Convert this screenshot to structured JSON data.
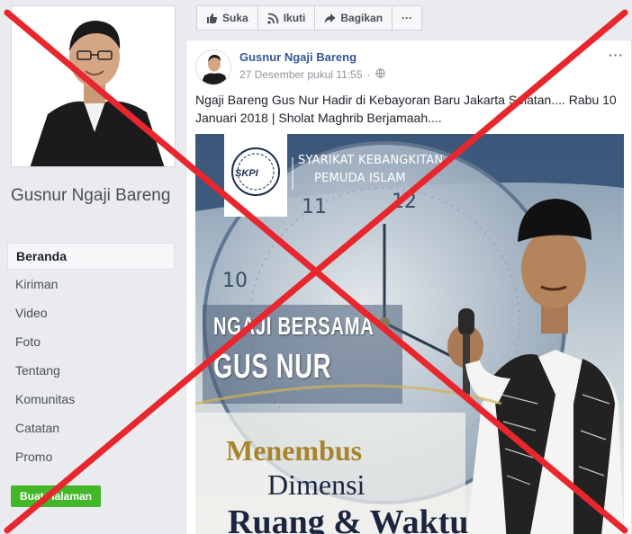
{
  "page": {
    "name": "Gusnur Ngaji Bareng"
  },
  "sidebar": {
    "items": [
      {
        "label": "Beranda",
        "active": true
      },
      {
        "label": "Kiriman",
        "active": false
      },
      {
        "label": "Video",
        "active": false
      },
      {
        "label": "Foto",
        "active": false
      },
      {
        "label": "Tentang",
        "active": false
      },
      {
        "label": "Komunitas",
        "active": false
      },
      {
        "label": "Catatan",
        "active": false
      },
      {
        "label": "Promo",
        "active": false
      }
    ],
    "create_button": "Buat Halaman"
  },
  "actions": {
    "like": "Suka",
    "follow": "Ikuti",
    "share": "Bagikan",
    "more": "···"
  },
  "post": {
    "author": "Gusnur Ngaji Bareng",
    "time": "27 Desember pukul 11:55",
    "visibility_icon": "globe-icon",
    "more": "···",
    "text": "Ngaji Bareng Gus Nur Hadir di Kebayoran Baru Jakarta Selatan.... Rabu 10 Januari 2018 | Sholat Maghrib Berjamaah...."
  },
  "poster": {
    "badge": "SKPI",
    "org_line1": "SYARIKAT KEBANGKITAN",
    "org_line2": "PEMUDA ISLAM",
    "headline_line1": "NGAJI BERSAMA",
    "headline_line2": "GUS NUR",
    "title_line1": "Menembus",
    "title_line2": "Dimensi",
    "title_line3": "Ruang & Waktu"
  },
  "colors": {
    "link": "#365899",
    "create_button": "#42b72a",
    "overlay_x": "#e8262d",
    "background": "#e9ebee"
  }
}
